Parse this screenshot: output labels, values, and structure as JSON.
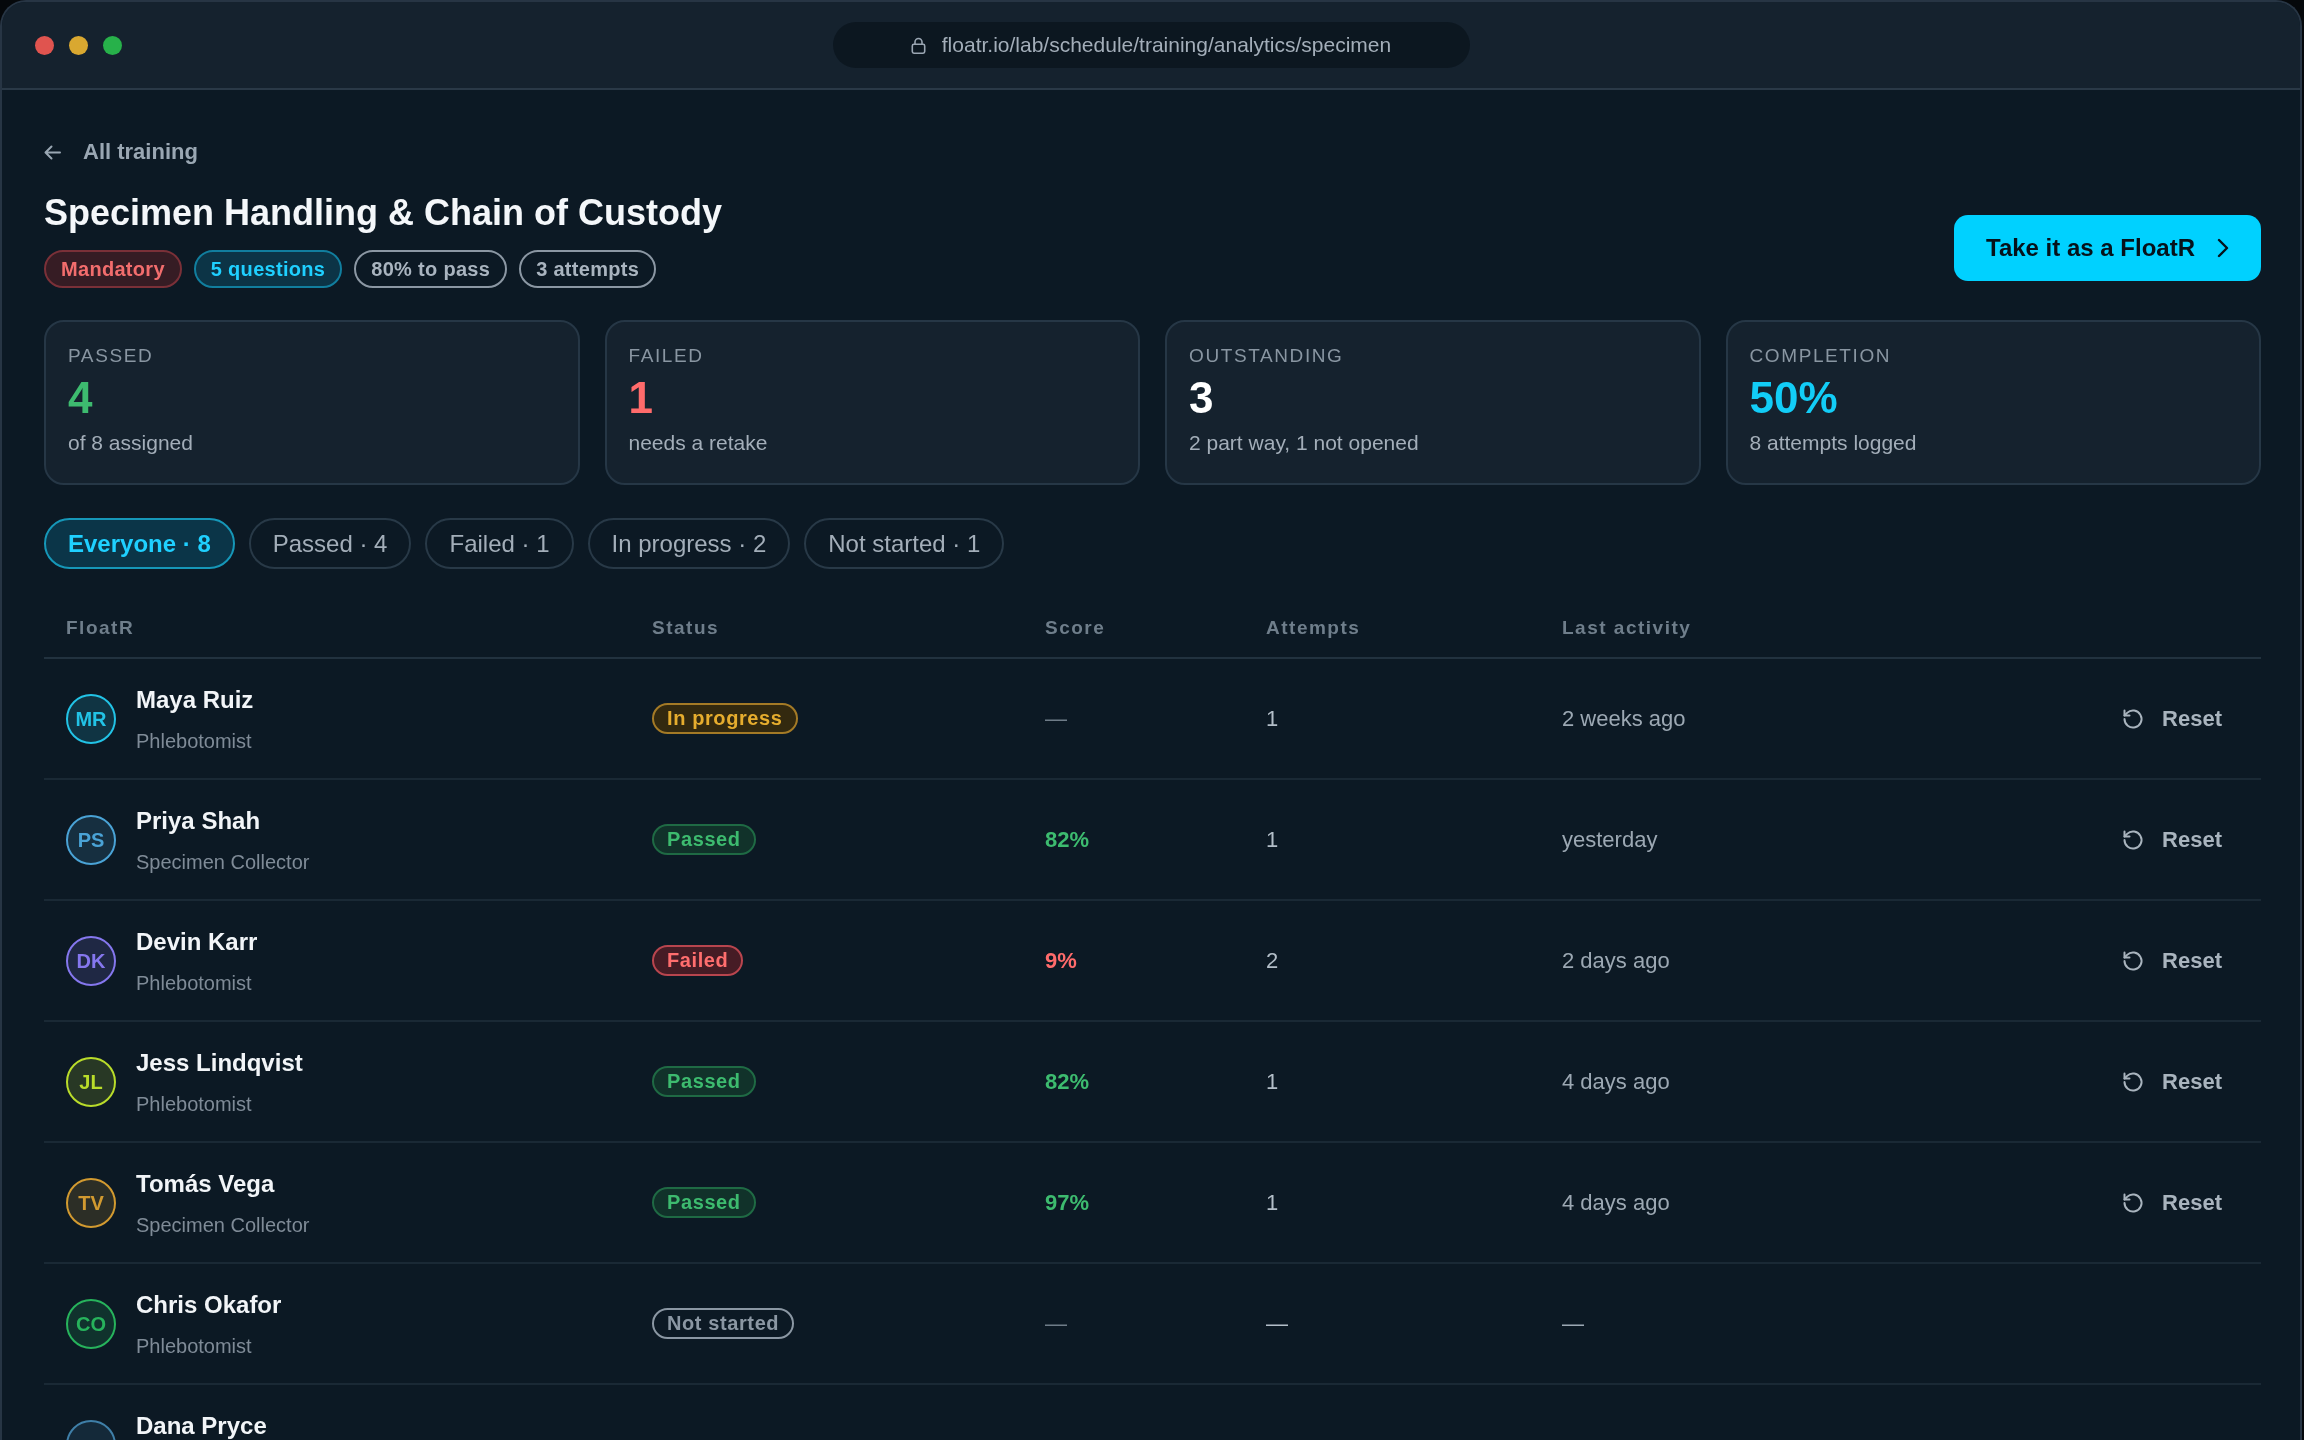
{
  "window": {
    "url": "floatr.io/lab/schedule/training/analytics/specimen"
  },
  "back_link": {
    "label": "All training"
  },
  "header": {
    "title": "Specimen Handling & Chain of Custody",
    "tags": [
      {
        "label": "Mandatory",
        "kind": "alert"
      },
      {
        "label": "5 questions",
        "kind": "info"
      },
      {
        "label": "80% to pass",
        "kind": "neutral"
      },
      {
        "label": "3 attempts",
        "kind": "neutral"
      }
    ],
    "primary_button": {
      "label": "Take it as a FloatR"
    }
  },
  "stats": [
    {
      "label": "PASSED",
      "value": "4",
      "caption": "of 8 assigned",
      "kind": "passed"
    },
    {
      "label": "FAILED",
      "value": "1",
      "caption": "needs a retake",
      "kind": "failed"
    },
    {
      "label": "OUTSTANDING",
      "value": "3",
      "caption": "2 part way, 1 not opened",
      "kind": "outstanding"
    },
    {
      "label": "COMPLETION",
      "value": "50%",
      "caption": "8 attempts logged",
      "kind": "completion"
    }
  ],
  "filters": [
    {
      "label": "Everyone · 8",
      "selected": true
    },
    {
      "label": "Passed · 4",
      "selected": false
    },
    {
      "label": "Failed · 1",
      "selected": false
    },
    {
      "label": "In progress · 2",
      "selected": false
    },
    {
      "label": "Not started · 1",
      "selected": false
    }
  ],
  "table": {
    "columns": [
      "FloatR",
      "Status",
      "Score",
      "Attempts",
      "Last activity"
    ],
    "rows": [
      {
        "initials": "MR",
        "color": "#22c3e6",
        "name": "Maya Ruiz",
        "role": "Phlebotomist",
        "status": {
          "kind": "in_progress",
          "label": "In progress"
        },
        "score": "—",
        "attempts": "1",
        "last_activity": "2 weeks ago",
        "action": "Reset"
      },
      {
        "initials": "PS",
        "color": "#4aa3d6",
        "name": "Priya Shah",
        "role": "Specimen Collector",
        "status": {
          "kind": "passed",
          "label": "Passed"
        },
        "score": "82%",
        "attempts": "1",
        "last_activity": "yesterday",
        "action": "Reset"
      },
      {
        "initials": "DK",
        "color": "#8577ee",
        "name": "Devin Karr",
        "role": "Phlebotomist",
        "status": {
          "kind": "failed",
          "label": "Failed"
        },
        "score": "9%",
        "attempts": "2",
        "last_activity": "2 days ago",
        "action": "Reset"
      },
      {
        "initials": "JL",
        "color": "#b9dc2a",
        "name": "Jess Lindqvist",
        "role": "Phlebotomist",
        "status": {
          "kind": "passed",
          "label": "Passed"
        },
        "score": "82%",
        "attempts": "1",
        "last_activity": "4 days ago",
        "action": "Reset"
      },
      {
        "initials": "TV",
        "color": "#d29a30",
        "name": "Tomás Vega",
        "role": "Specimen Collector",
        "status": {
          "kind": "passed",
          "label": "Passed"
        },
        "score": "97%",
        "attempts": "1",
        "last_activity": "4 days ago",
        "action": "Reset"
      },
      {
        "initials": "CO",
        "color": "#27b35c",
        "name": "Chris Okafor",
        "role": "Phlebotomist",
        "status": {
          "kind": "not_started",
          "label": "Not started"
        },
        "score": "—",
        "attempts": "—",
        "last_activity": "—"
      },
      {
        "color": "#3f7fa8",
        "name": "Dana Pryce"
      }
    ]
  }
}
